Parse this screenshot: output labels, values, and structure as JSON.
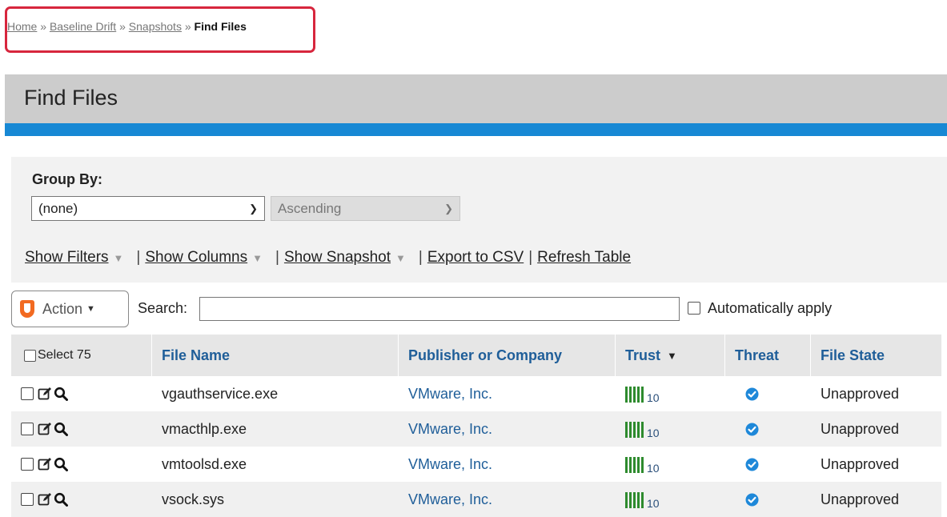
{
  "breadcrumb": {
    "items": [
      "Home",
      "Baseline Drift",
      "Snapshots"
    ],
    "separator": "»",
    "current": "Find Files"
  },
  "page": {
    "title": "Find Files"
  },
  "group_by": {
    "label": "Group By:",
    "field_value": "(none)",
    "order_value": "Ascending"
  },
  "links": {
    "show_filters": "Show Filters",
    "show_columns": "Show Columns",
    "show_snapshot": "Show Snapshot",
    "export_csv": "Export to CSV",
    "refresh": "Refresh Table"
  },
  "toolbar": {
    "action_label": "Action",
    "search_label": "Search:",
    "search_value": "",
    "auto_apply_label": "Automatically apply"
  },
  "table": {
    "select_label": "Select 75",
    "headers": {
      "file_name": "File Name",
      "publisher": "Publisher or Company",
      "trust": "Trust",
      "threat": "Threat",
      "file_state": "File State"
    },
    "rows": [
      {
        "file_name": "vgauthservice.exe",
        "publisher": "VMware, Inc.",
        "trust": "10",
        "file_state": "Unapproved"
      },
      {
        "file_name": "vmacthlp.exe",
        "publisher": "VMware, Inc.",
        "trust": "10",
        "file_state": "Unapproved"
      },
      {
        "file_name": "vmtoolsd.exe",
        "publisher": "VMware, Inc.",
        "trust": "10",
        "file_state": "Unapproved"
      },
      {
        "file_name": "vsock.sys",
        "publisher": "VMware, Inc.",
        "trust": "10",
        "file_state": "Unapproved"
      }
    ]
  },
  "colors": {
    "title_bar": "#cccccc",
    "accent_blue": "#1788d4",
    "link_blue": "#1f5e99",
    "trust_green": "#2e8b2e",
    "threat_icon": "#1e88d9",
    "action_shield": "#f26a21",
    "highlight_red": "#d7263d"
  },
  "icons": {
    "action": "shield-icon",
    "edit": "edit-icon",
    "details": "search-icon",
    "threat": "check-circle-icon",
    "trust": "trust-bars-icon"
  }
}
